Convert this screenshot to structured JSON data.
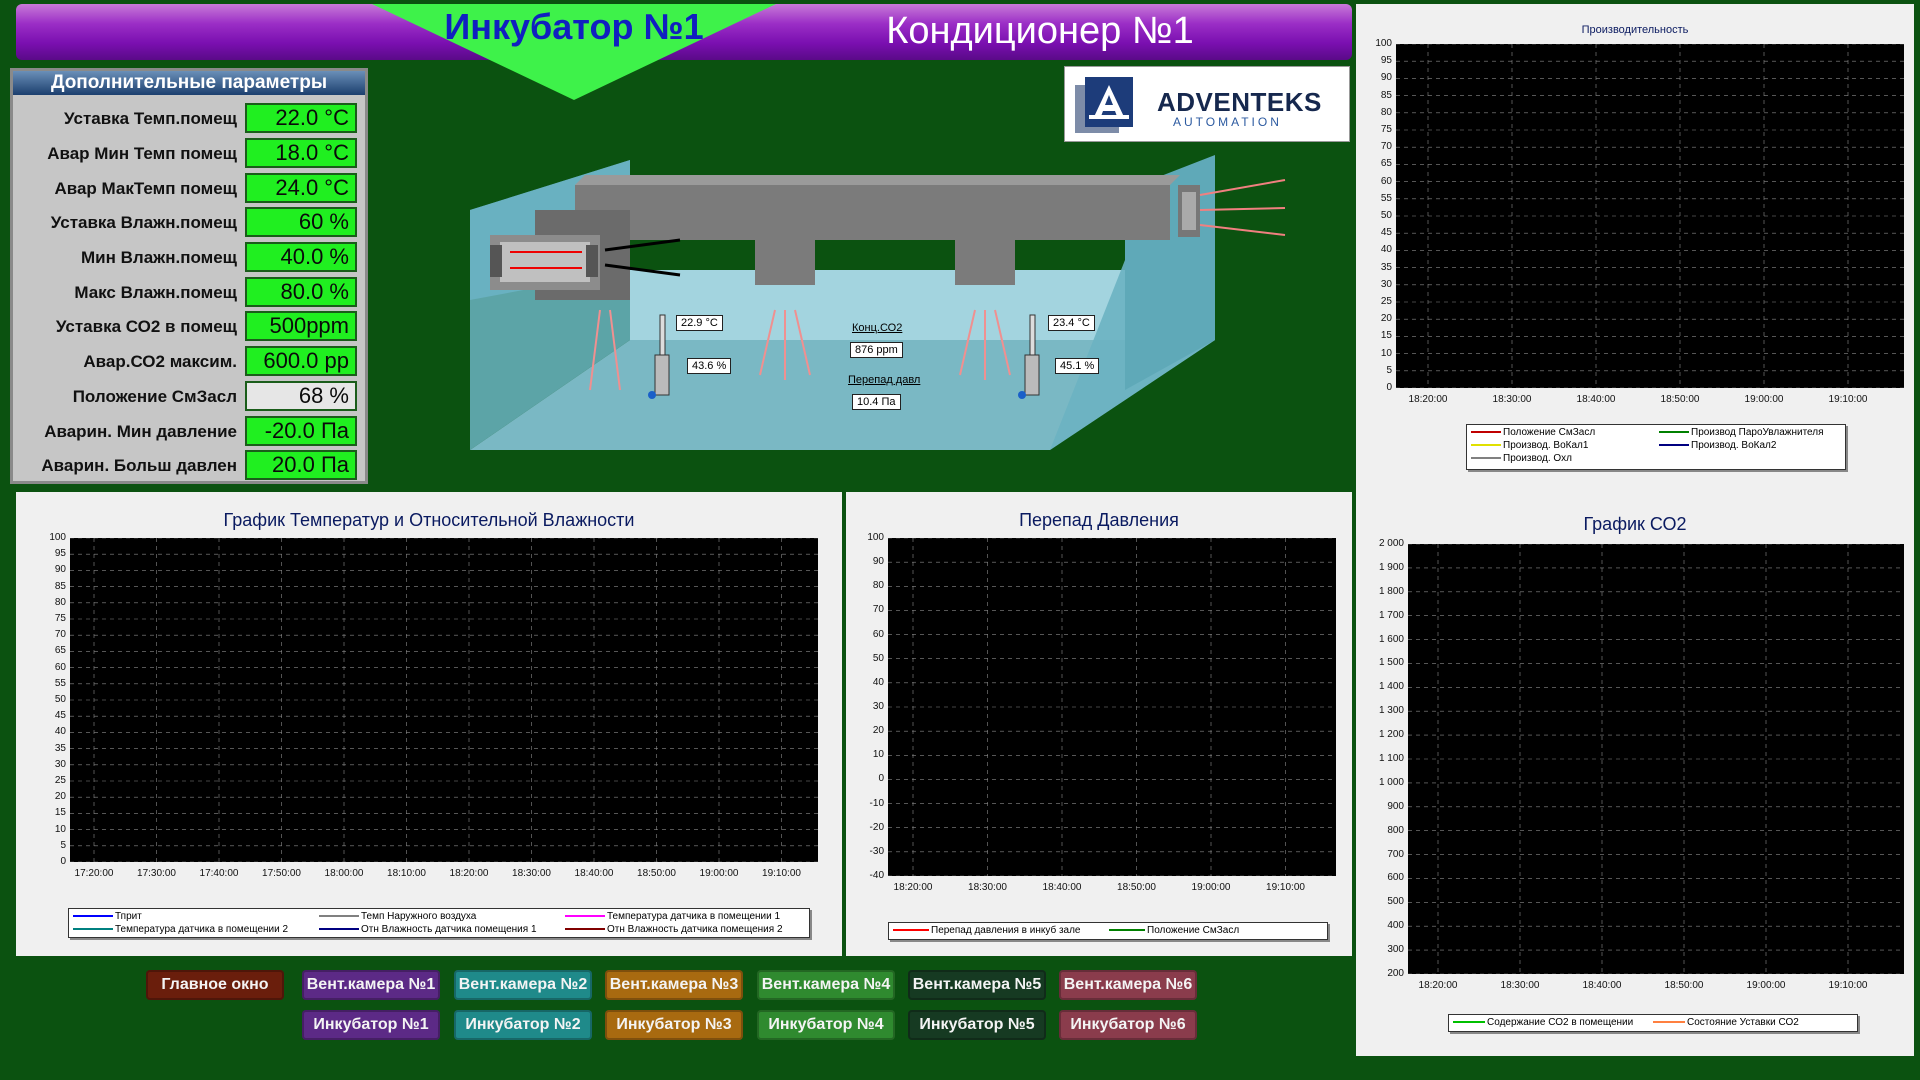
{
  "header": {
    "title": "Инкубатор №1",
    "subtitle": "Кондиционер №1"
  },
  "params": {
    "heading": "Дополнительные параметры",
    "rows": [
      {
        "label": "Уставка Темп.помещ",
        "value": "22.0 °C",
        "style": "green"
      },
      {
        "label": "Авар Мин Темп помещ",
        "value": "18.0 °C",
        "style": "green"
      },
      {
        "label": "Авар МакТемп помещ",
        "value": "24.0 °C",
        "style": "green"
      },
      {
        "label": "Уставка Влажн.помещ",
        "value": "60 %",
        "style": "green"
      },
      {
        "label": "Мин Влажн.помещ",
        "value": "40.0 %",
        "style": "green"
      },
      {
        "label": "Макс Влажн.помещ",
        "value": "80.0 %",
        "style": "green"
      },
      {
        "label": "Уставка СО2 в помещ",
        "value": "500ppm",
        "style": "green"
      },
      {
        "label": "Авар.СО2 максим.",
        "value": "600.0 pp",
        "style": "green"
      },
      {
        "label": "Положение СмЗасл",
        "value": "68 %",
        "style": "gray"
      },
      {
        "label": "Аварин. Мин давление",
        "value": "-20.0 Па",
        "style": "green"
      },
      {
        "label": "Аварин. Больш давлен",
        "value": "20.0 Па",
        "style": "green"
      }
    ]
  },
  "logo": {
    "name": "ADVENTEKS",
    "tagline": "AUTOMATION"
  },
  "schema": {
    "temp1": "22.9 °C",
    "hum1": "43.6 %",
    "temp2": "23.4 °C",
    "hum2": "45.1 %",
    "co2_label": "Конц.СО2",
    "co2_value": "876 ppm",
    "dp_label": "Перепад давл",
    "dp_value": "10.4 Па"
  },
  "charts": {
    "temp": {
      "title": "График Температур и Относительной Влажности",
      "yticks": [
        "100",
        "95",
        "90",
        "85",
        "80",
        "75",
        "70",
        "65",
        "60",
        "55",
        "50",
        "45",
        "40",
        "35",
        "30",
        "25",
        "20",
        "15",
        "10",
        "5",
        "0"
      ],
      "xticks": [
        "17:20:00",
        "17:30:00",
        "17:40:00",
        "17:50:00",
        "18:00:00",
        "18:10:00",
        "18:20:00",
        "18:30:00",
        "18:40:00",
        "18:50:00",
        "19:00:00",
        "19:10:00"
      ],
      "legend": [
        {
          "name": "Тприт",
          "color": "#0000ff"
        },
        {
          "name": "Темп Наружного воздуха",
          "color": "#808080"
        },
        {
          "name": "Температура датчика в помещении 1",
          "color": "#ff00ff"
        },
        {
          "name": "Температура датчика в помещении 2",
          "color": "#008080"
        },
        {
          "name": "Отн Влажность датчика помещения 1",
          "color": "#000080"
        },
        {
          "name": "Отн Влажность датчика помещения 2",
          "color": "#800000"
        }
      ]
    },
    "pressure": {
      "title": "Перепад Давления",
      "yticks": [
        "100",
        "90",
        "80",
        "70",
        "60",
        "50",
        "40",
        "30",
        "20",
        "10",
        "0",
        "-10",
        "-20",
        "-30",
        "-40"
      ],
      "xticks": [
        "18:20:00",
        "18:30:00",
        "18:40:00",
        "18:50:00",
        "19:00:00",
        "19:10:00"
      ],
      "legend": [
        {
          "name": "Перепад давления в инкуб зале",
          "color": "#ff0000"
        },
        {
          "name": "Положение СмЗасл",
          "color": "#008000"
        }
      ]
    },
    "co2": {
      "title": "График СО2",
      "yticks": [
        "2 000",
        "1 900",
        "1 800",
        "1 700",
        "1 600",
        "1 500",
        "1 400",
        "1 300",
        "1 200",
        "1 100",
        "1 000",
        "900",
        "800",
        "700",
        "600",
        "500",
        "400",
        "300",
        "200"
      ],
      "xticks": [
        "18:20:00",
        "18:30:00",
        "18:40:00",
        "18:50:00",
        "19:00:00",
        "19:10:00"
      ],
      "legend": [
        {
          "name": "Содержание СО2 в помещении",
          "color": "#00c000"
        },
        {
          "name": "Состояние Уставки СО2",
          "color": "#ff8040"
        }
      ]
    },
    "perf": {
      "title": "Производительность",
      "yticks": [
        "100",
        "95",
        "90",
        "85",
        "80",
        "75",
        "70",
        "65",
        "60",
        "55",
        "50",
        "45",
        "40",
        "35",
        "30",
        "25",
        "20",
        "15",
        "10",
        "5",
        "0"
      ],
      "xticks": [
        "18:20:00",
        "18:30:00",
        "18:40:00",
        "18:50:00",
        "19:00:00",
        "19:10:00"
      ],
      "legend": [
        {
          "name": "Положение СмЗасл",
          "color": "#c00000"
        },
        {
          "name": "Производ ПароУвлажнителя",
          "color": "#008000"
        },
        {
          "name": "Производ. ВоКал1",
          "color": "#e0e000"
        },
        {
          "name": "Производ. ВоКал2",
          "color": "#000080"
        },
        {
          "name": "Производ. Охл",
          "color": "#808080"
        }
      ]
    }
  },
  "nav": {
    "row1": [
      {
        "label": "Главное окно",
        "color": "#6a1e0c"
      },
      {
        "label": "Вент.камера №1",
        "color": "#5c2a86"
      },
      {
        "label": "Вент.камера №2",
        "color": "#1f8a8a"
      },
      {
        "label": "Вент.камера №3",
        "color": "#a86a10"
      },
      {
        "label": "Вент.камера №4",
        "color": "#2f8a2f"
      },
      {
        "label": "Вент.камера №5",
        "color": "#163a22"
      },
      {
        "label": "Вент.камера №6",
        "color": "#8a3c4c"
      }
    ],
    "row2": [
      {
        "label": "Инкубатор №1",
        "color": "#5c2a86"
      },
      {
        "label": "Инкубатор №2",
        "color": "#1f8a8a"
      },
      {
        "label": "Инкубатор №3",
        "color": "#a86a10"
      },
      {
        "label": "Инкубатор №4",
        "color": "#2f8a2f"
      },
      {
        "label": "Инкубатор №5",
        "color": "#163a22"
      },
      {
        "label": "Инкубатор №6",
        "color": "#8a3c4c"
      }
    ]
  }
}
